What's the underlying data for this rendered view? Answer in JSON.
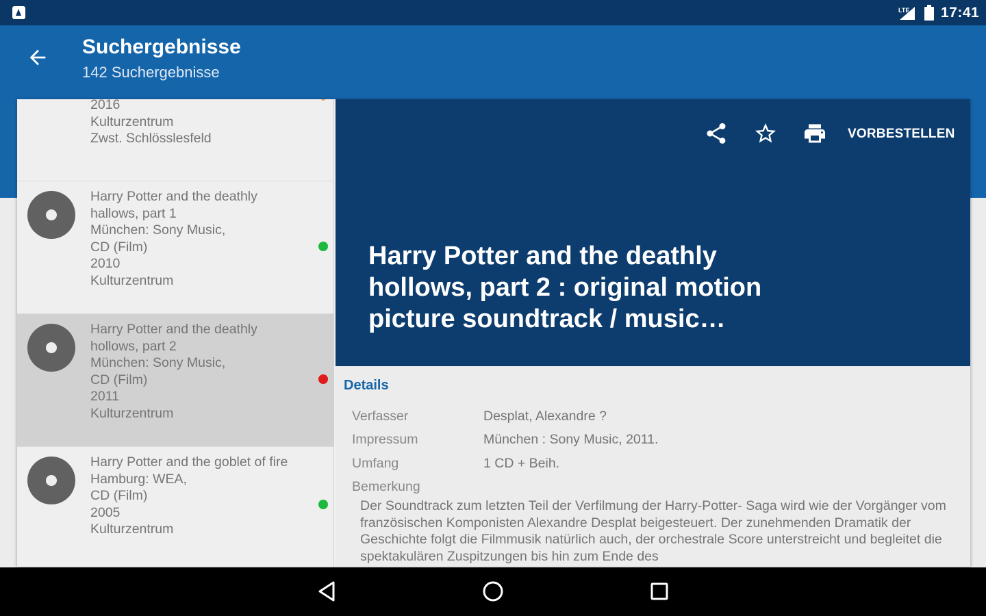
{
  "status_bar": {
    "time": "17:41",
    "icons": [
      "notification-icon",
      "signal-icon",
      "battery-icon"
    ]
  },
  "app_bar": {
    "title": "Suchergebnisse",
    "subtitle": "142 Suchergebnisse",
    "back_icon": "arrow-back-icon"
  },
  "results": [
    {
      "lines": [
        "2016",
        "Kulturzentrum",
        "Zwst. Schlösslesfeld"
      ],
      "status": "partial"
    },
    {
      "lines": [
        "Harry Potter and the deathly",
        "hallows, part 1",
        "München: Sony Music,",
        "CD (Film)",
        "2010",
        "Kulturzentrum"
      ],
      "status": "available",
      "icon": "cd-icon"
    },
    {
      "lines": [
        "Harry Potter and the deathly",
        "hollows, part 2",
        "München: Sony Music,",
        "CD (Film)",
        "2011",
        "Kulturzentrum"
      ],
      "status": "unavailable",
      "selected": true,
      "icon": "cd-icon"
    },
    {
      "lines": [
        "Harry Potter and the goblet of fire",
        "Hamburg: WEA,",
        "CD (Film)",
        "2005",
        "Kulturzentrum"
      ],
      "status": "available",
      "icon": "cd-icon"
    }
  ],
  "detail": {
    "actions": {
      "share_icon": "share-icon",
      "favorite_icon": "star-outline-icon",
      "print_icon": "print-icon",
      "preorder_label": "VORBESTELLEN"
    },
    "title": "Harry Potter and the deathly hollows, part 2 : original motion picture soundtrack / music…",
    "section_title": "Details",
    "fields": [
      {
        "label": "Verfasser",
        "value": "Desplat, Alexandre ?"
      },
      {
        "label": "Impressum",
        "value": "München : Sony Music, 2011."
      },
      {
        "label": "Umfang",
        "value": "1 CD + Beih."
      }
    ],
    "remark_label": "Bemerkung",
    "remark_text": "Der Soundtrack zum letzten Teil der Verfilmung der Harry-Potter- Saga wird wie der Vorgänger vom französischen Komponisten Alexandre Desplat beigesteuert. Der zunehmenden Dramatik der Geschichte folgt die Filmmusik natürlich auch, der orchestrale Score unterstreicht und begleitet die spektakulären Zuspitzungen bis hin zum Ende des"
  },
  "nav_bar": {
    "back_icon": "nav-back-icon",
    "home_icon": "nav-home-icon",
    "recents_icon": "nav-recents-icon"
  },
  "colors": {
    "status_bar": "#0a3766",
    "app_bar": "#1565ab",
    "detail_header": "#0c3d6e",
    "available": "#1db93e",
    "unavailable": "#e01b1b"
  }
}
